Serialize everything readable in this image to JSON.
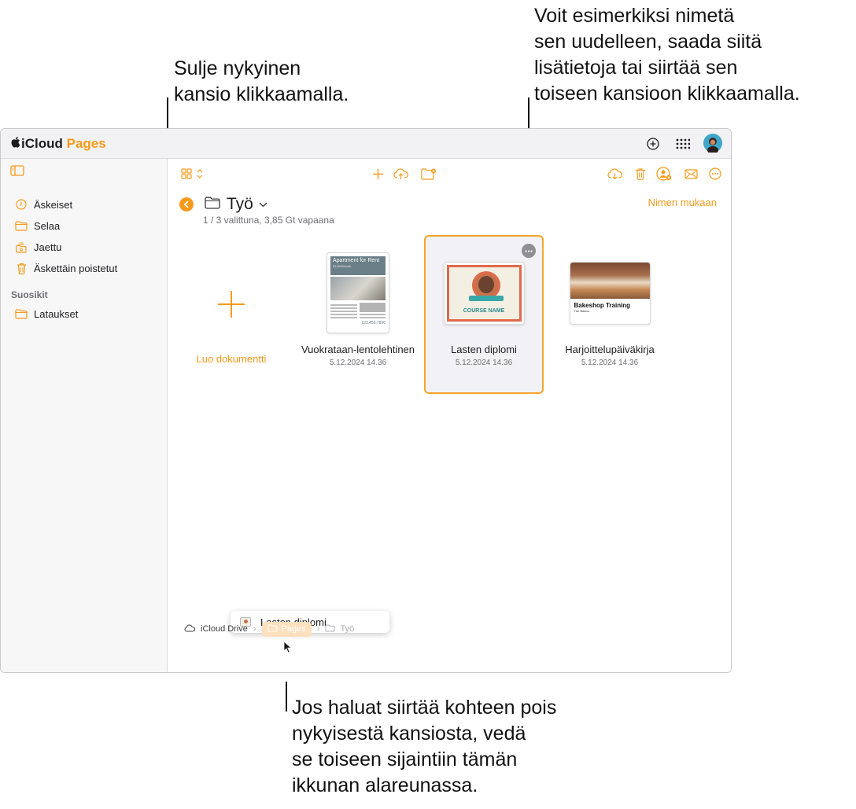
{
  "callouts": {
    "close_folder": "Sulje nykyinen\nkansio klikkaamalla.",
    "more_options": "Voit esimerkiksi nimetä\nsen uudelleen, saada siitä\nlisätietoja tai siirtää sen\ntoiseen kansioon klikkaamalla.",
    "drag_move": "Jos haluat siirtää kohteen pois\nnykyisestä kansiosta, vedä\nse toiseen sijaintiin tämän\nikkunan alareunassa."
  },
  "app": {
    "brand_prefix": "iCloud",
    "brand_name": "Pages"
  },
  "sidebar": {
    "items": [
      {
        "label": "Äskeiset",
        "icon": "clock-icon"
      },
      {
        "label": "Selaa",
        "icon": "folder-icon"
      },
      {
        "label": "Jaettu",
        "icon": "shared-folder-icon"
      },
      {
        "label": "Äskettäin poistetut",
        "icon": "trash-icon"
      }
    ],
    "favorites_header": "Suosikit",
    "favorites": [
      {
        "label": "Lataukset",
        "icon": "folder-icon"
      }
    ]
  },
  "folder": {
    "name": "Työ",
    "status": "1 / 3 valittuna, 3,85 Gt vapaana",
    "sort_label": "Nimen mukaan"
  },
  "documents": [
    {
      "name": "Luo dokumentti",
      "kind": "create"
    },
    {
      "name": "Vuokrataan-lentolehtinen",
      "date": "5.12.2024 14.36",
      "thumb_title": "Apartment for Rent",
      "thumb_sub": "$1400/Month",
      "thumb_phone": "123.456.7890"
    },
    {
      "name": "Lasten diplomi",
      "date": "5.12.2024 14.36",
      "thumb_title": "COURSE NAME",
      "selected": true
    },
    {
      "name": "Harjoittelupäiväkirja",
      "date": "5.12.2024 14.36",
      "thumb_title": "Bakeshop Training",
      "thumb_sub": "The Basics"
    }
  ],
  "drag_preview": {
    "label": "Lasten diplomi"
  },
  "breadcrumb": {
    "root": "iCloud Drive",
    "pages": "Pages",
    "current": "Työ"
  },
  "colors": {
    "accent": "#f79a1b",
    "selection_border": "#f7a52b"
  }
}
